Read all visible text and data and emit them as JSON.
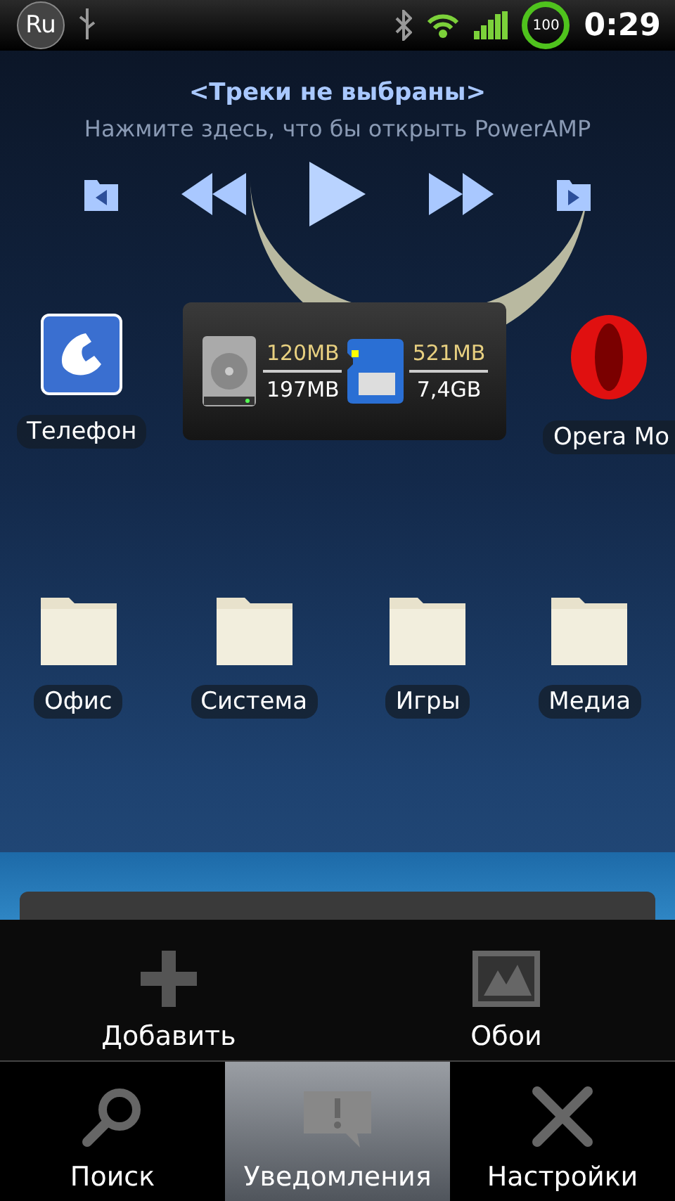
{
  "status_bar": {
    "language": "Ru",
    "battery": "100",
    "time": "0:29"
  },
  "music_widget": {
    "title": "<Треки не выбраны>",
    "subtitle": "Нажмите здесь, что бы открыть PowerAMP"
  },
  "row_1": {
    "phone": {
      "label": "Телефон"
    },
    "storage": {
      "internal_free": "120MB",
      "internal_total": "197MB",
      "sd_free": "521MB",
      "sd_total": "7,4GB"
    },
    "browser": {
      "label": "Opera Mo"
    }
  },
  "folders": [
    {
      "label": "Офис"
    },
    {
      "label": "Система"
    },
    {
      "label": "Игры"
    },
    {
      "label": "Медиа"
    }
  ],
  "menu": {
    "top": [
      {
        "label": "Добавить",
        "kind": "add"
      },
      {
        "label": "Обои",
        "kind": "wallpaper"
      }
    ],
    "bottom": [
      {
        "label": "Поиск",
        "kind": "search",
        "selected": false
      },
      {
        "label": "Уведомления",
        "kind": "notifications",
        "selected": true
      },
      {
        "label": "Настройки",
        "kind": "settings",
        "selected": false
      }
    ]
  }
}
